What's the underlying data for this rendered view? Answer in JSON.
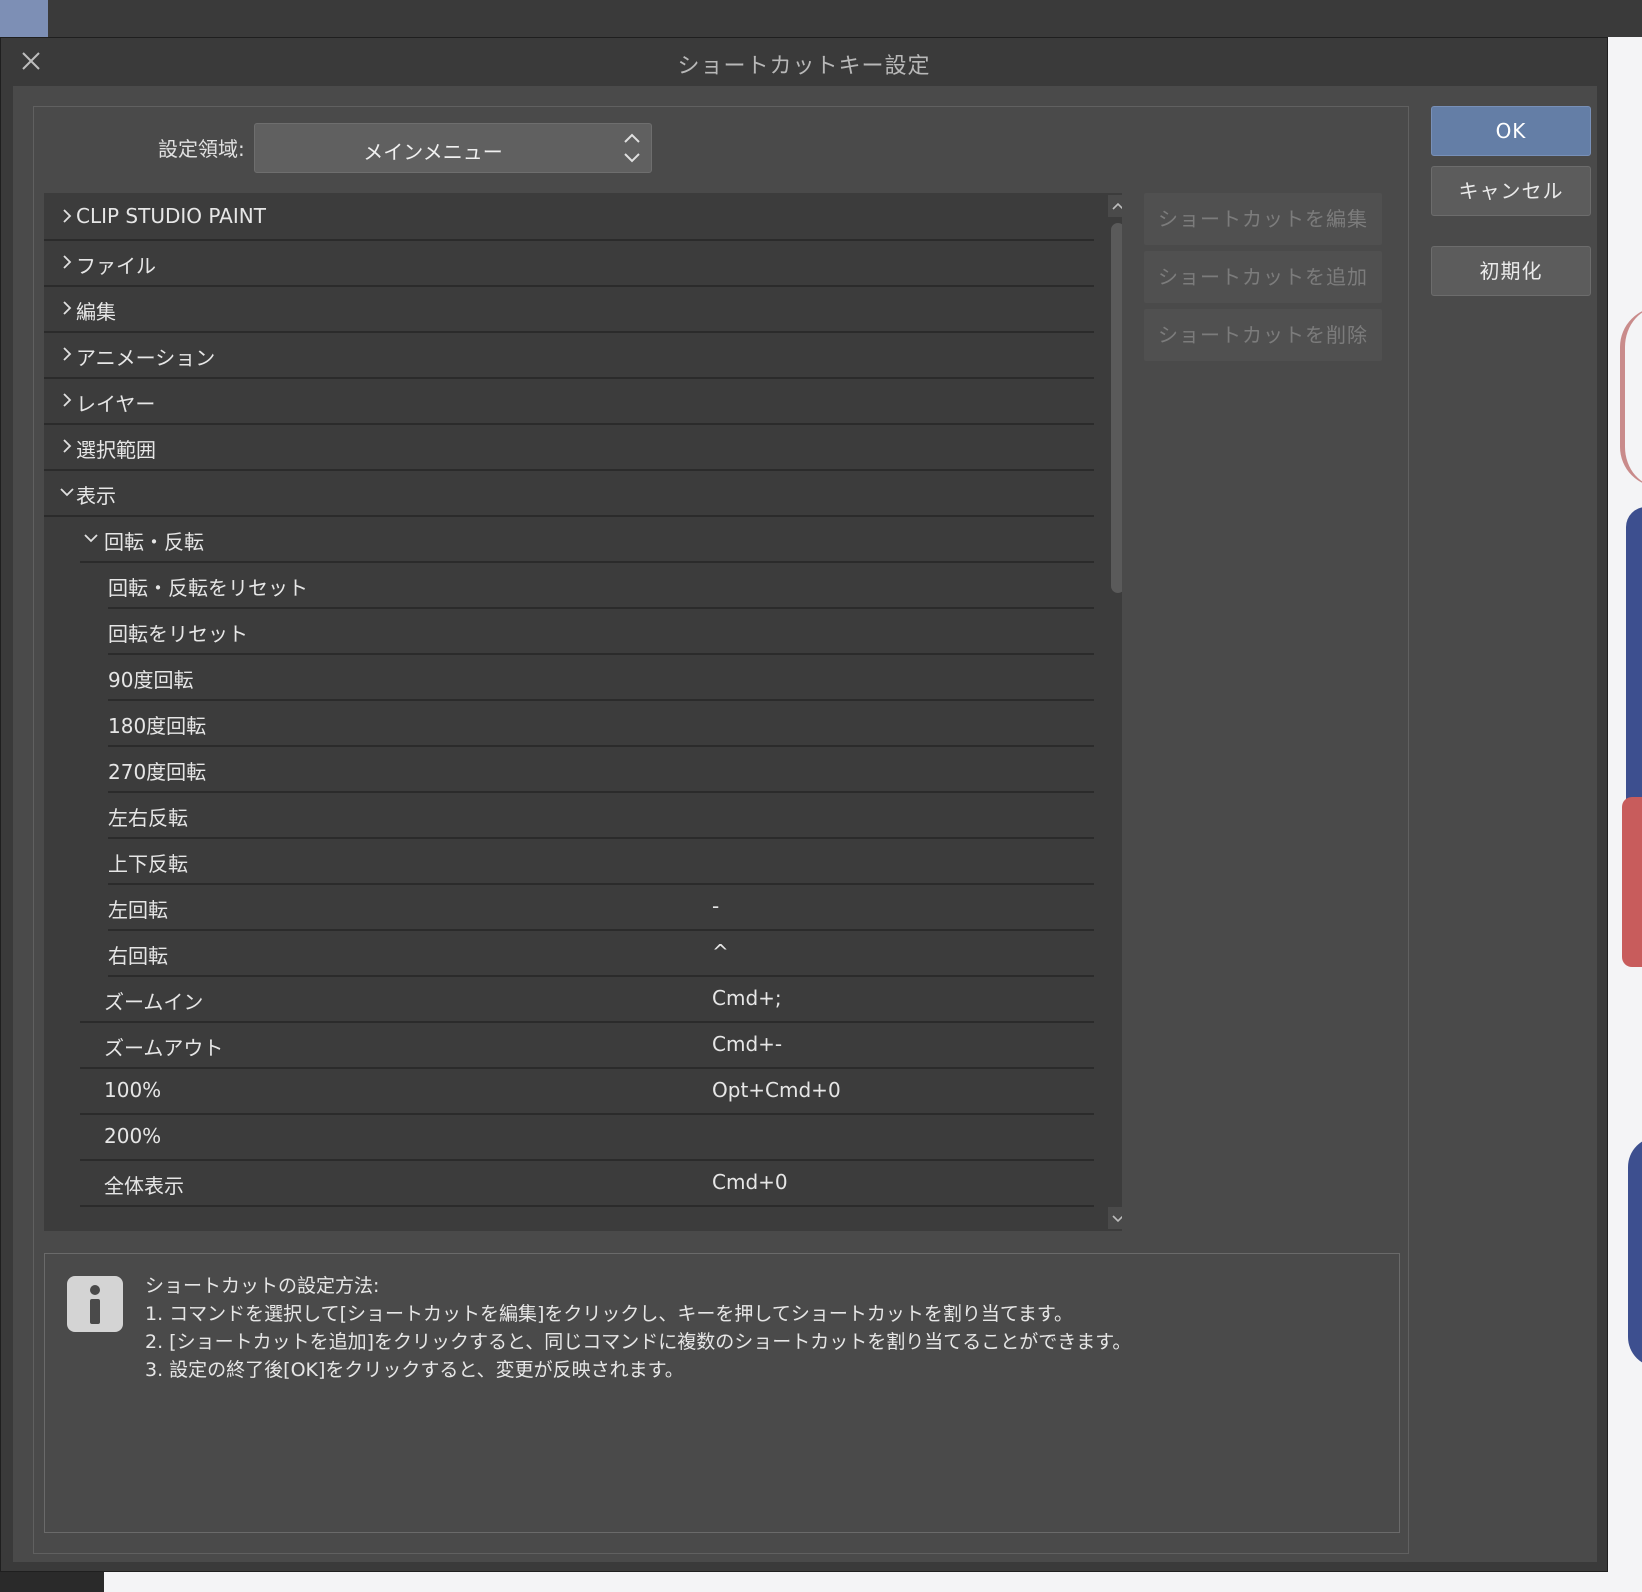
{
  "dialog": {
    "title": "ショートカットキー設定"
  },
  "setting_area": {
    "label": "設定領域:",
    "value": "メインメニュー"
  },
  "tree": {
    "rows": [
      {
        "label": "CLIP STUDIO PAINT",
        "key": "",
        "level": 0,
        "state": "collapsed"
      },
      {
        "label": "ファイル",
        "key": "",
        "level": 0,
        "state": "collapsed"
      },
      {
        "label": "編集",
        "key": "",
        "level": 0,
        "state": "collapsed"
      },
      {
        "label": "アニメーション",
        "key": "",
        "level": 0,
        "state": "collapsed"
      },
      {
        "label": "レイヤー",
        "key": "",
        "level": 0,
        "state": "collapsed"
      },
      {
        "label": "選択範囲",
        "key": "",
        "level": 0,
        "state": "collapsed"
      },
      {
        "label": "表示",
        "key": "",
        "level": 0,
        "state": "expanded"
      },
      {
        "label": "回転・反転",
        "key": "",
        "level": 1,
        "state": "expanded"
      },
      {
        "label": "回転・反転をリセット",
        "key": "",
        "level": 2,
        "state": "leaf"
      },
      {
        "label": "回転をリセット",
        "key": "",
        "level": 2,
        "state": "leaf"
      },
      {
        "label": "90度回転",
        "key": "",
        "level": 2,
        "state": "leaf"
      },
      {
        "label": "180度回転",
        "key": "",
        "level": 2,
        "state": "leaf"
      },
      {
        "label": "270度回転",
        "key": "",
        "level": 2,
        "state": "leaf"
      },
      {
        "label": "左右反転",
        "key": "",
        "level": 2,
        "state": "leaf"
      },
      {
        "label": "上下反転",
        "key": "",
        "level": 2,
        "state": "leaf"
      },
      {
        "label": "左回転",
        "key": "-",
        "level": 2,
        "state": "leaf"
      },
      {
        "label": "右回転",
        "key": "^",
        "level": 2,
        "state": "leaf"
      },
      {
        "label": "ズームイン",
        "key": "Cmd+;",
        "level": 1,
        "state": "leaf"
      },
      {
        "label": "ズームアウト",
        "key": "Cmd+-",
        "level": 1,
        "state": "leaf"
      },
      {
        "label": "100%",
        "key": "Opt+Cmd+0",
        "level": 1,
        "state": "leaf"
      },
      {
        "label": "200%",
        "key": "",
        "level": 1,
        "state": "leaf"
      },
      {
        "label": "全体表示",
        "key": "Cmd+0",
        "level": 1,
        "state": "leaf"
      }
    ]
  },
  "side_buttons": {
    "edit": "ショートカットを編集",
    "add": "ショートカットを追加",
    "delete": "ショートカットを削除"
  },
  "info": {
    "heading": "ショートカットの設定方法:",
    "line1": "1. コマンドを選択して[ショートカットを編集]をクリックし、キーを押してショートカットを割り当てます。",
    "line2": "2. [ショートカットを追加]をクリックすると、同じコマンドに複数のショートカットを割り当てることができます。",
    "line3": "3. 設定の終了後[OK]をクリックすると、変更が反映されます。"
  },
  "actions": {
    "ok": "OK",
    "cancel": "キャンセル",
    "reset": "初期化"
  },
  "colors": {
    "accent": "#647ea6",
    "dialog_bg": "#4a4a4a",
    "list_bg": "#3c3c3c"
  }
}
